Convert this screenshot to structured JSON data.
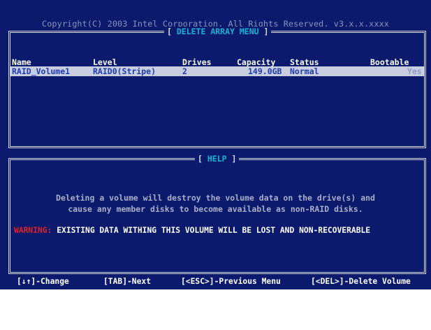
{
  "copyright": "Copyright(C) 2003 Intel Corporation. All Rights Reserved. v3.x.x.xxxx",
  "menu_title": "DELETE ARRAY MENU",
  "help_title": "HELP",
  "table": {
    "headers": [
      "Name",
      "Level",
      "Drives",
      "Capacity",
      "Status",
      "Bootable"
    ],
    "rows": [
      {
        "name": "RAID_Volume1",
        "level": "RAID0(Stripe)",
        "drives": "2",
        "capacity": "149.0GB",
        "status": "Normal",
        "bootable": "Yes"
      }
    ]
  },
  "help": {
    "line1": "Deleting a volume will destroy the volume data on the drive(s) and",
    "line2": "cause any member disks to become available as non-RAID disks.",
    "warning_tag": "WARNING:",
    "warning_text": " EXISTING DATA WITHING THIS VOLUME WILL BE LOST AND NON-RECOVERABLE"
  },
  "keybar": {
    "change": "[↓↑]-Change",
    "next": "[TAB]-Next",
    "previous": "[<ESC>]-Previous Menu",
    "delete": "[<DEL>]-Delete Volume"
  },
  "colors": {
    "background": "#0c1a6e",
    "frame": "#d8d8d8",
    "accent": "#19b2d6",
    "highlight_row": "#c8cde0",
    "highlight_text": "#1c3bb0",
    "warning": "#e02020"
  }
}
